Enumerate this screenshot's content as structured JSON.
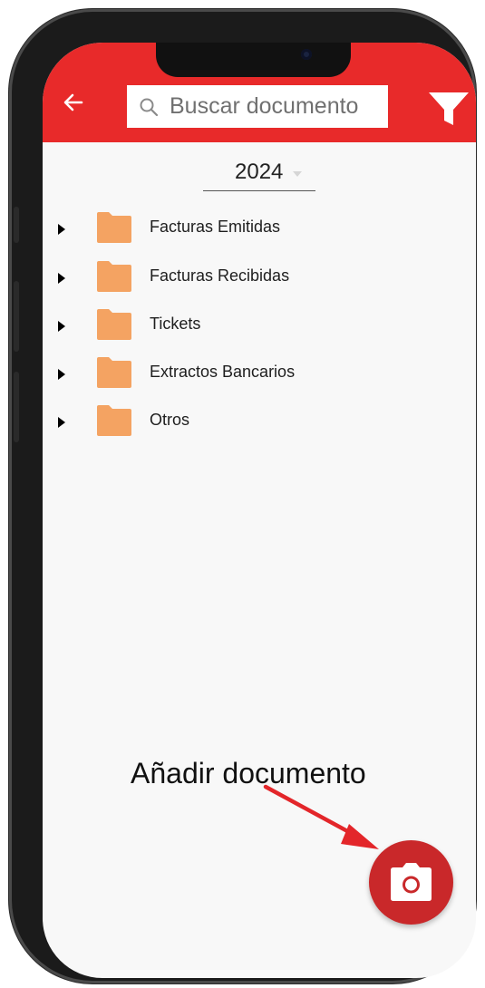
{
  "search": {
    "placeholder": "Buscar documento"
  },
  "year_select": {
    "value": "2024"
  },
  "folders": [
    {
      "label": "Facturas Emitidas"
    },
    {
      "label": "Facturas Recibidas"
    },
    {
      "label": "Tickets"
    },
    {
      "label": "Extractos Bancarios"
    },
    {
      "label": "Otros"
    }
  ],
  "annotation": {
    "text": "Añadir documento"
  },
  "colors": {
    "topbar": "#e82a2a",
    "folder": "#f4a362",
    "fab": "#c9282a"
  },
  "icons": {
    "back": "arrow-left-icon",
    "search": "search-icon",
    "filter": "filter-icon",
    "expand": "triangle-right-icon",
    "folder": "folder-icon",
    "fab": "camera-icon"
  }
}
